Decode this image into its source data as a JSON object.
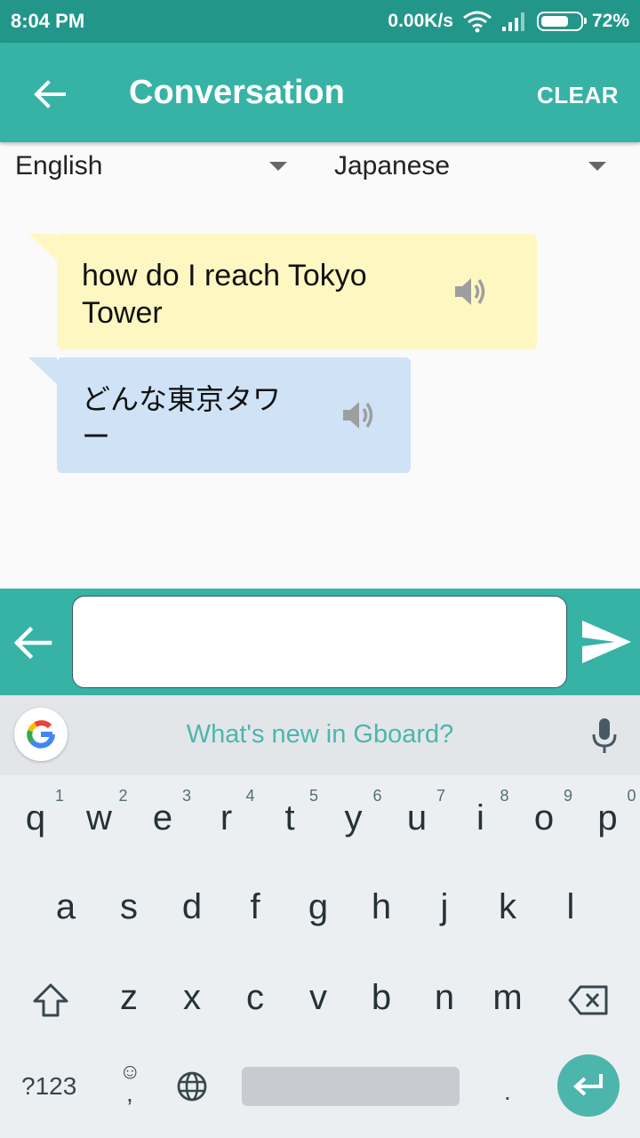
{
  "status_bar": {
    "time": "8:04 PM",
    "net_speed": "0.00K/s",
    "battery": "72%",
    "battery_level": 0.72
  },
  "app_bar": {
    "title": "Conversation",
    "clear_label": "CLEAR"
  },
  "languages": {
    "source": "English",
    "target": "Japanese"
  },
  "messages": [
    {
      "text": "how do I reach Tokyo Tower",
      "color": "#fff7c1"
    },
    {
      "text": "どんな東京タワー",
      "color": "#cfe2f6"
    }
  ],
  "input": {
    "value": ""
  },
  "keyboard": {
    "suggestion": "What's new in Gboard?",
    "row1": [
      {
        "k": "q",
        "h": "1"
      },
      {
        "k": "w",
        "h": "2"
      },
      {
        "k": "e",
        "h": "3"
      },
      {
        "k": "r",
        "h": "4"
      },
      {
        "k": "t",
        "h": "5"
      },
      {
        "k": "y",
        "h": "6"
      },
      {
        "k": "u",
        "h": "7"
      },
      {
        "k": "i",
        "h": "8"
      },
      {
        "k": "o",
        "h": "9"
      },
      {
        "k": "p",
        "h": "0"
      }
    ],
    "row2": [
      "a",
      "s",
      "d",
      "f",
      "g",
      "h",
      "j",
      "k",
      "l"
    ],
    "row3": [
      "z",
      "x",
      "c",
      "v",
      "b",
      "n",
      "m"
    ],
    "symbols_label": "?123",
    "emoji_label": "☺",
    "comma_label": ",",
    "period_label": "."
  },
  "colors": {
    "accent": "#37b3a6",
    "status_bar": "#23968a",
    "suggestion": "#4db6ac"
  },
  "icons": [
    "back-arrow-icon",
    "speaker-icon",
    "send-icon",
    "google-g-icon",
    "mic-icon",
    "shift-icon",
    "backspace-icon",
    "globe-icon",
    "enter-icon",
    "wifi-icon",
    "signal-icon",
    "battery-icon"
  ]
}
